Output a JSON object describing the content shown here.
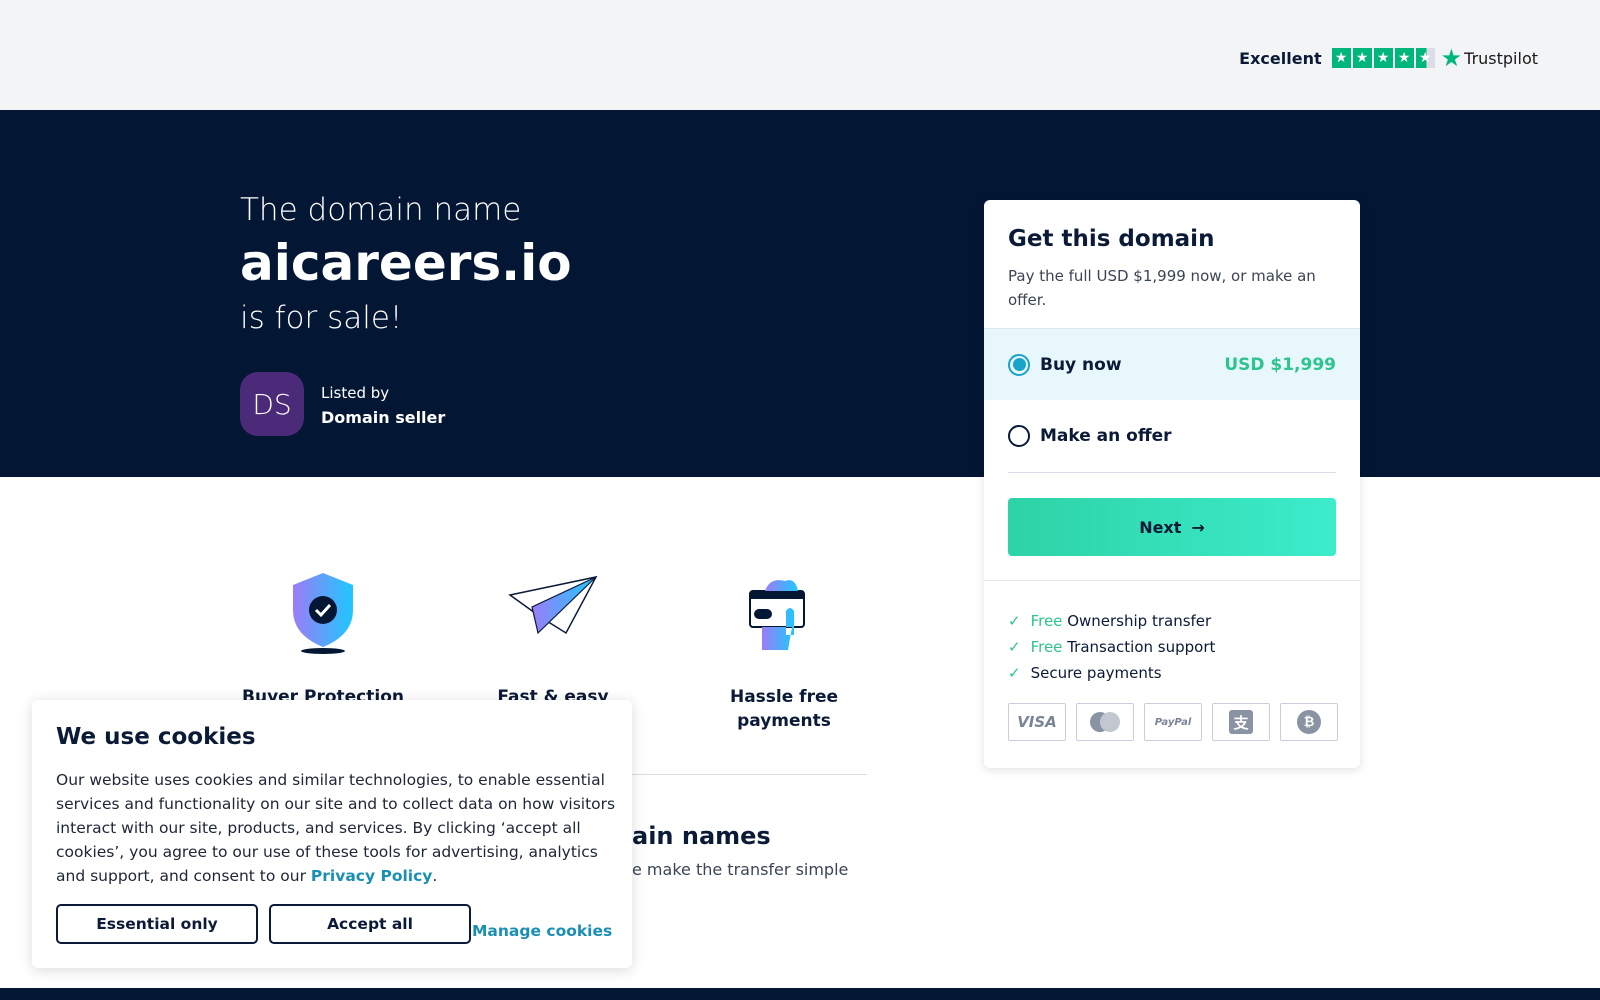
{
  "trustpilot": {
    "rating_label": "Excellent",
    "brand": "Trustpilot",
    "stars": 4.5
  },
  "hero": {
    "line1": "The domain name",
    "domain": "aicareers.io",
    "line3": "is for sale!",
    "avatar_initials": "DS",
    "listed_by": "Listed by",
    "seller": "Domain seller"
  },
  "card": {
    "title": "Get this domain",
    "subtitle": "Pay the full USD $1,999 now, or make an offer.",
    "options": [
      {
        "label": "Buy now",
        "price": "USD $1,999",
        "selected": true
      },
      {
        "label": "Make an offer",
        "selected": false
      }
    ],
    "next_label": "Next",
    "features": [
      {
        "free": "Free",
        "text": "Ownership transfer"
      },
      {
        "free": "Free",
        "text": "Transaction support"
      },
      {
        "free": "",
        "text": "Secure payments"
      }
    ],
    "payments": [
      "VISA",
      "Mastercard",
      "PayPal",
      "Alipay",
      "Bitcoin"
    ]
  },
  "benefits": [
    "Buyer Protection",
    "Fast & easy",
    "Hassle free payments"
  ],
  "section": {
    "title_fragment": "ain names",
    "text_fragment": "e make the transfer simple"
  },
  "cookies": {
    "title": "We use cookies",
    "body": "Our website uses cookies and similar technologies, to enable essential services and functionality on our site and to collect data on how visitors interact with our site, products, and services. By clicking ‘accept all cookies’, you agree to our use of these tools for advertising, analytics and support, and consent to our ",
    "link": "Privacy Policy",
    "period": ".",
    "essential": "Essential only",
    "accept": "Accept all",
    "manage": "Manage cookies"
  },
  "colors": {
    "navy": "#031634",
    "green": "#2ec48e",
    "link": "#1a8fb4"
  }
}
